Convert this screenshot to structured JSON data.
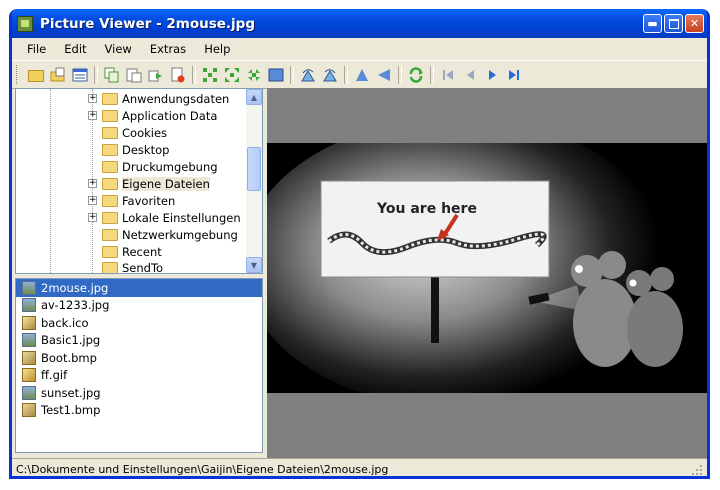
{
  "window": {
    "title": "Picture Viewer - 2mouse.jpg"
  },
  "menu": [
    "File",
    "Edit",
    "View",
    "Extras",
    "Help"
  ],
  "tree": {
    "items": [
      {
        "label": "Anwendungsdaten",
        "expandable": true
      },
      {
        "label": "Application Data",
        "expandable": true
      },
      {
        "label": "Cookies",
        "expandable": false
      },
      {
        "label": "Desktop",
        "expandable": false
      },
      {
        "label": "Druckumgebung",
        "expandable": false
      },
      {
        "label": "Eigene Dateien",
        "expandable": true,
        "selected": true
      },
      {
        "label": "Favoriten",
        "expandable": true
      },
      {
        "label": "Lokale Einstellungen",
        "expandable": true
      },
      {
        "label": "Netzwerkumgebung",
        "expandable": false
      },
      {
        "label": "Recent",
        "expandable": false
      },
      {
        "label": "SendTo",
        "expandable": false
      }
    ]
  },
  "files": [
    {
      "name": "2mouse.jpg",
      "type": "jpg",
      "selected": true
    },
    {
      "name": "av-1233.jpg",
      "type": "jpg"
    },
    {
      "name": "back.ico",
      "type": "ico"
    },
    {
      "name": "Basic1.jpg",
      "type": "jpg"
    },
    {
      "name": "Boot.bmp",
      "type": "bmp"
    },
    {
      "name": "ff.gif",
      "type": "gif"
    },
    {
      "name": "sunset.jpg",
      "type": "jpg"
    },
    {
      "name": "Test1.bmp",
      "type": "bmp"
    }
  ],
  "image": {
    "sign_text": "You are here"
  },
  "status": {
    "path": "C:\\Dokumente und Einstellungen\\Gaijin\\Eigene Dateien\\2mouse.jpg"
  }
}
